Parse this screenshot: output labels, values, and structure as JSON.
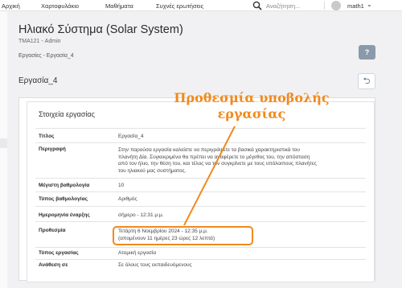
{
  "nav": {
    "items": [
      "Αρχική",
      "Χαρτοφυλάκιο",
      "Μαθήματα",
      "Συχνές ερωτήσεις"
    ],
    "search_placeholder": "Αναζήτηση...",
    "username": "math1"
  },
  "header": {
    "title": "Ηλιακό Σύστημα (Solar System)",
    "course": "ΤΜΑ121 - Admin",
    "breadcrumb": "Εργασίες - Εργασία_4",
    "help_label": "?"
  },
  "section": {
    "title": "Εργασία_4"
  },
  "details": {
    "heading": "Στοιχεία εργασίας",
    "rows": [
      {
        "label": "Τίτλος",
        "value": "Εργασία_4"
      },
      {
        "label": "Περιγραφή",
        "value_lines": [
          "Στην παρούσα εργασία καλείστε να περιγράψετε τα βασικά χαρακτηριστικά του",
          "πλανήτη Δία. Συγκεκριμένα θα πρέπει να αναφέρετε το μέγεθος του, την απόσταση",
          "από τον ήλιο, την θέση του, και τέλος να τον συγκρίνετε με τους υπόλοιπους πλανήτες",
          "του ηλιακού μας συστήματος."
        ]
      },
      {
        "label": "Μέγιστη βαθμολογία",
        "value": "10"
      },
      {
        "label": "Τύπος βαθμολογίας",
        "value": "Αριθμός"
      },
      {
        "label": "Ημερομηνία έναρξης",
        "value": "σήμερο - 12:31 μ.μ."
      },
      {
        "label": "Προθεσμία",
        "value_lines": [
          "Τετάρτη 6 Νοεμβρίου 2024 - 12:35 μ.μ.",
          "(απομένουν 11 ημέρες 23 ώρες 12 λεπτά)"
        ]
      },
      {
        "label": "Τύπος εργασίας",
        "value": "Ατομική εργασία"
      },
      {
        "label": "Ανάθεση σε",
        "value": "Σε όλους τους εκπαιδευόμενους"
      }
    ]
  },
  "annotation": {
    "line1": "Προθεσμία υποβολής",
    "line2": "εργασίας",
    "color": "#f08a1e"
  }
}
